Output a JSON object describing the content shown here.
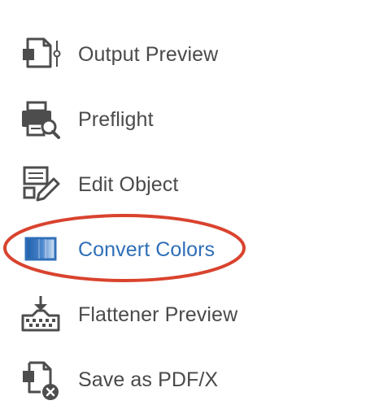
{
  "tools": [
    {
      "label": "Output Preview",
      "icon": "output-preview-icon"
    },
    {
      "label": "Preflight",
      "icon": "preflight-icon"
    },
    {
      "label": "Edit Object",
      "icon": "edit-object-icon"
    },
    {
      "label": "Convert Colors",
      "icon": "convert-colors-icon",
      "highlighted": true
    },
    {
      "label": "Flattener Preview",
      "icon": "flattener-preview-icon"
    },
    {
      "label": "Save as PDF/X",
      "icon": "save-as-pdfx-icon"
    }
  ],
  "colors": {
    "label_text": "#4a4a4a",
    "active_label_text": "#2f6fb8",
    "icon_gray": "#4d4d4d",
    "active_icon_blue": "#2f6fb8",
    "highlight_circle": "#d9432e"
  }
}
